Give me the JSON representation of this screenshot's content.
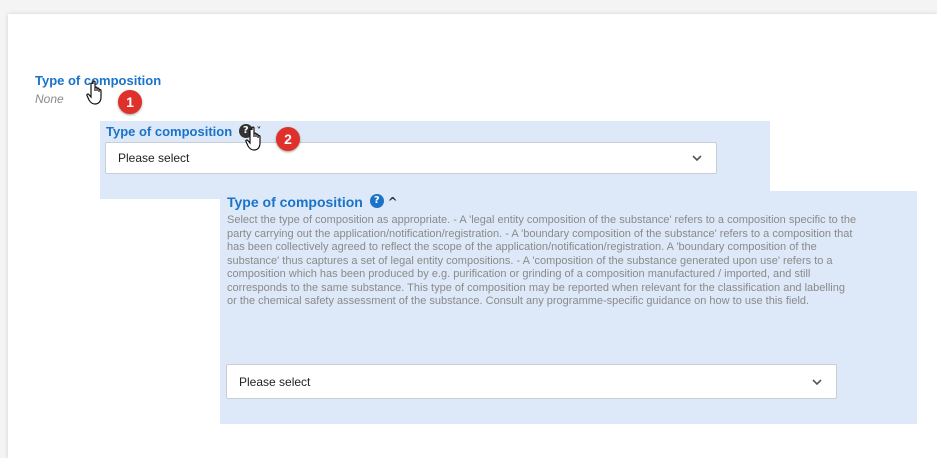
{
  "field": {
    "label": "Type of composition",
    "value": "None"
  },
  "inline_editor": {
    "label": "Type of composition",
    "help_icon": "question-icon",
    "toggle": "˅",
    "select_value": "Please select"
  },
  "expanded_editor": {
    "label": "Type of composition",
    "help_icon": "question-icon",
    "toggle": "^",
    "help_text": "Select the type of composition as appropriate. - A 'legal entity composition of the substance' refers to a composition specific to the party carrying out the application/notification/registration. - A 'boundary composition of the substance' refers to a composition that has been collectively agreed to reflect the scope of the application/notification/registration. A 'boundary composition of the substance' thus captures a set of legal entity compositions. - A 'composition of the substance generated upon use' refers to a composition which has been produced by e.g. purification or grinding of a composition manufactured / imported, and still corresponds to the same substance. This type of composition may be reported when relevant for the classification and labelling or the chemical safety assessment of the substance. Consult any programme-specific guidance on how to use this field.",
    "select_value": "Please select"
  },
  "callouts": {
    "step1": "1",
    "step2": "2"
  },
  "colors": {
    "label_blue": "#1a73c8",
    "panel_blue": "#dde9f8",
    "badge_red": "#e0302b"
  }
}
